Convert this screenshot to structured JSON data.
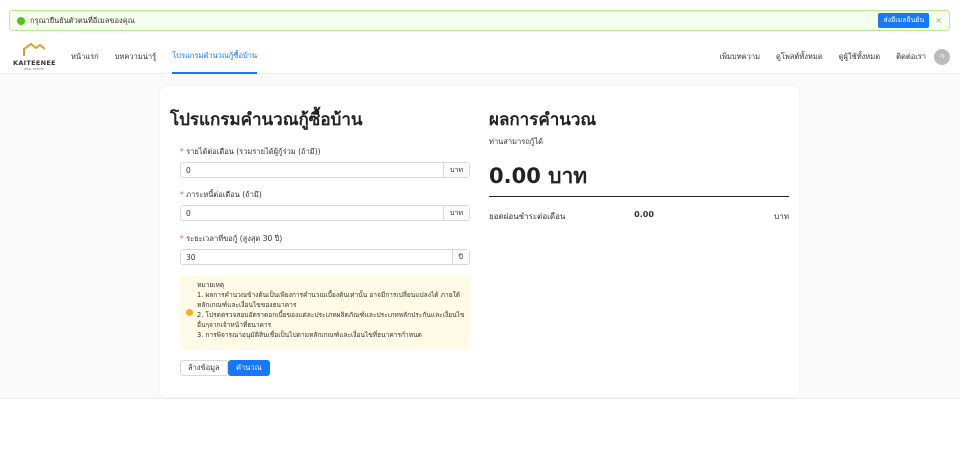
{
  "alert": {
    "message": "กรุณายืนยันตัวตนที่อีเมลของคุณ",
    "button": "ส่งอีเมลยืนยัน",
    "close": "×"
  },
  "nav": {
    "logo": {
      "name": "KAITEENEE",
      "sub": "REAL ESTATE"
    },
    "left": [
      "หน้าแรก",
      "บทความน่ารู้",
      "โปรแกรมคำนวณกู้ซื้อบ้าน"
    ],
    "right": [
      "เพิ่มบทความ",
      "ดูโพสต์ทั้งหมด",
      "ดูผู้ใช้ทั้งหมด",
      "ติดต่อเรา"
    ],
    "avatar": "ก"
  },
  "form": {
    "title": "โปรแกรมคำนวณกู้ซื้อบ้าน",
    "fields": [
      {
        "label": "รายได้ต่อเดือน (รวมรายได้ผู้กู้ร่วม (ถ้ามี))",
        "value": "0",
        "suffix": "บาท"
      },
      {
        "label": "ภาระหนี้ต่อเดือน (ถ้ามี)",
        "value": "0",
        "suffix": "บาท"
      },
      {
        "label": "ระยะเวลาที่ขอกู้ (สูงสุด 30 ปี)",
        "value": "30",
        "suffix": "ปี"
      }
    ],
    "note": {
      "title": "หมายเหตุ",
      "lines": [
        "1. ผลการคำนวณข้างต้นเป็นเพียงการคำนวณเบื้องต้นเท่านั้น อาจมีการเปลี่ยนแปลงได้ ภายใต้หลักเกณฑ์และเงื่อนไขของธนาคาร",
        "2. โปรดตรวจสอบอัตราดอกเบี้ยของแต่ละประเภทผลิตภัณฑ์และประเภทหลักประกันและเงื่อนไขอื่นๆจากเจ้าหน้าที่ธนาคาร",
        "3. การพิจารณาอนุมัติสินเชื่อเป็นไปตามหลักเกณฑ์และเงื่อนไขที่ธนาคารกำหนด"
      ]
    },
    "clear": "ล้างข้อมูล",
    "calc": "คำนวณ"
  },
  "result": {
    "title": "ผลการคำนวณ",
    "can_borrow": "ท่านสามารถกู้ได้",
    "amount": "0.00 บาท",
    "monthly_label": "ยอดผ่อนชำระต่อเดือน",
    "monthly_value": "0.00",
    "monthly_unit": "บาท"
  }
}
